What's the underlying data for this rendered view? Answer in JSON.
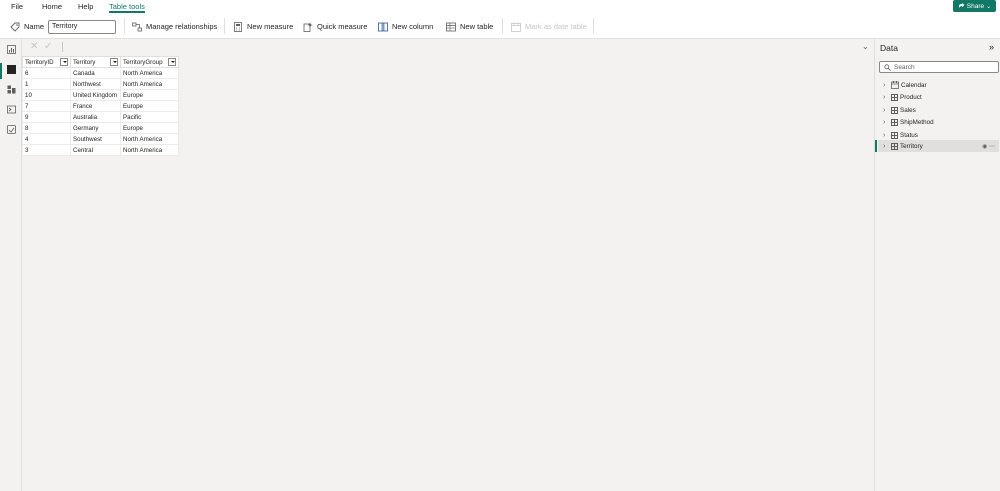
{
  "menu": {
    "items": [
      "File",
      "Home",
      "Help",
      "Table tools"
    ],
    "active_index": 3,
    "share_label": "Share"
  },
  "ribbon": {
    "name_label": "Name",
    "name_value": "Territory",
    "manage_relationships": "Manage relationships",
    "new_measure": "New measure",
    "quick_measure": "Quick measure",
    "new_column": "New column",
    "new_table": "New table",
    "mark_as_date_table": "Mark as date table"
  },
  "formula_bar": {
    "cancel_icon": "close-icon",
    "commit_icon": "check-icon"
  },
  "table": {
    "columns": [
      "TerritoryID",
      "Territory",
      "TerritoryGroup"
    ],
    "rows": [
      [
        "6",
        "Canada",
        "North America"
      ],
      [
        "1",
        "Northwest",
        "North America"
      ],
      [
        "10",
        "United Kingdom",
        "Europe"
      ],
      [
        "7",
        "France",
        "Europe"
      ],
      [
        "9",
        "Australia",
        "Pacific"
      ],
      [
        "8",
        "Germany",
        "Europe"
      ],
      [
        "4",
        "Southwest",
        "North America"
      ],
      [
        "3",
        "Central",
        "North America"
      ]
    ]
  },
  "data_pane": {
    "title": "Data",
    "search_placeholder": "Search",
    "tables": [
      "Calendar",
      "Product",
      "Sales",
      "ShipMethod",
      "Status",
      "Territory"
    ],
    "selected": "Territory"
  },
  "colors": {
    "accent": "#117865",
    "background": "#f3f2f1",
    "border": "#e1dfdd"
  }
}
